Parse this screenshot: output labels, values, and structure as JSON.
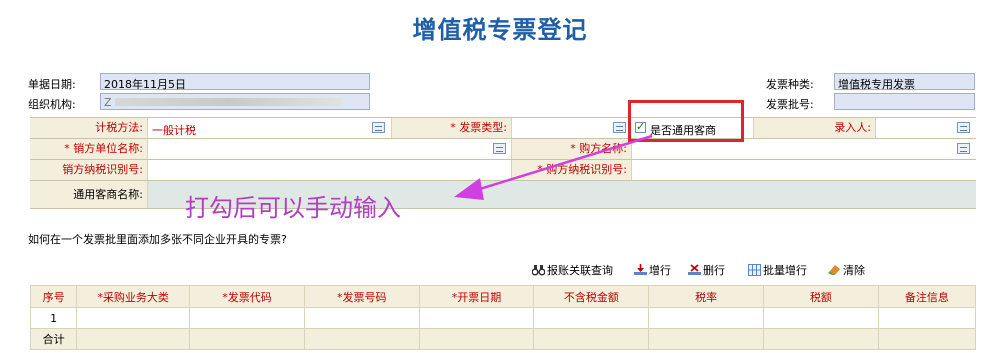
{
  "title": "增值税专票登记",
  "header": {
    "doc_date_label": "单据日期:",
    "doc_date_value": "2018年11月5日",
    "org_label": "组织机构:",
    "org_value": "Z",
    "invoice_type_label": "发票种类:",
    "invoice_type_value": "增值税专用发票",
    "batch_label": "发票批号:",
    "batch_value": ""
  },
  "form": {
    "tax_method_label": "计税方法:",
    "tax_method_value": "一般计税",
    "invoice_kind_label": "* 发票类型:",
    "general_merchant_checkbox_label": "是否通用客商",
    "general_merchant_checked": true,
    "entry_user_label": "录入人:",
    "seller_name_label": "* 销方单位名称:",
    "buyer_name_label": "* 购方名称:",
    "seller_taxid_label": "销方纳税识别号:",
    "buyer_taxid_label": "* 购方纳税识别号:",
    "general_merchant_name_label": "通用客商名称:"
  },
  "annotation": {
    "text": "打勾后可以手动输入",
    "color": "#b040c0"
  },
  "help_question": "如何在一个发票批里面添加多张不同企业开具的专票?",
  "toolbar": {
    "reimburse_query": "报账关联查询",
    "add_row": "增行",
    "delete_row": "删行",
    "batch_add_row": "批量增行",
    "clear": "清除"
  },
  "table": {
    "columns": [
      "序号",
      "*采购业务大类",
      "*发票代码",
      "*发票号码",
      "*开票日期",
      "不含税金额",
      "税率",
      "税额",
      "备注信息"
    ],
    "rows": [
      [
        "1",
        "",
        "",
        "",
        "",
        "",
        "",
        "",
        ""
      ]
    ],
    "total_label": "合计"
  },
  "colors": {
    "title": "#1f5fa8",
    "label_red": "#c00000",
    "highlight_box": "#e0242a",
    "label_bg": "#f3efdc",
    "field_blue": "#dde6f2"
  }
}
